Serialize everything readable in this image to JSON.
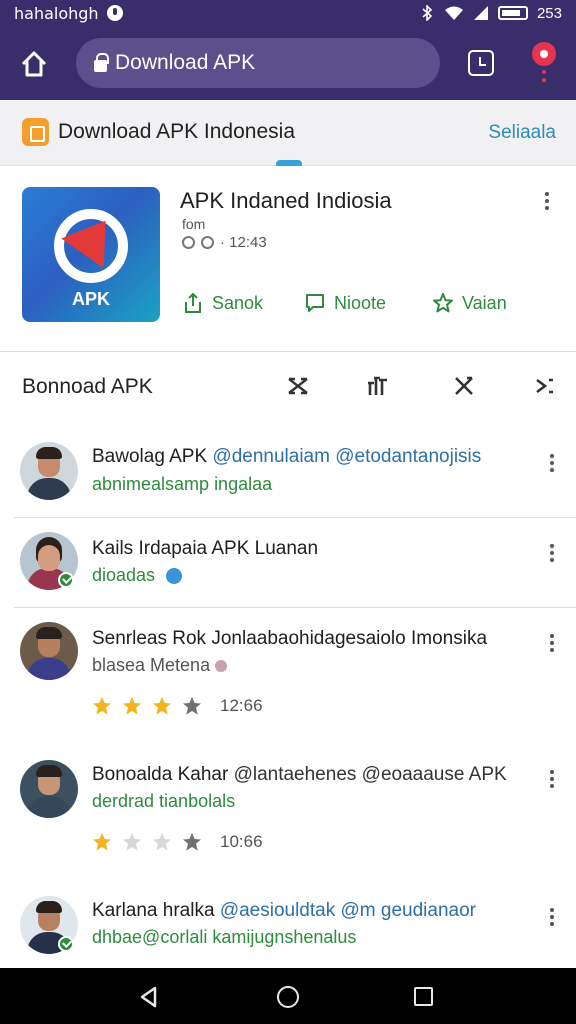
{
  "status_bar": {
    "carrier": "hahalohgh",
    "battery": "253"
  },
  "browser": {
    "url_text": "Download APK"
  },
  "site": {
    "title": "Download APK Indonesia",
    "link": "Seliaala"
  },
  "app": {
    "name": "APK Indaned Indiosia",
    "subtitle": "fom",
    "meta_time": "· 12:43",
    "icon_label": "APK",
    "actions": [
      {
        "label": "Sanok",
        "icon": "share-icon"
      },
      {
        "label": "Nioote",
        "icon": "comment-icon"
      },
      {
        "label": "Vaian",
        "icon": "star-outline-icon"
      }
    ]
  },
  "section": {
    "title": "Bonnoad APK"
  },
  "items": [
    {
      "name": "Bawolag APK",
      "mention": "@denn​u​laiam @etodantanojisis",
      "line2": "abnimealsamp ingalaa",
      "verified": false
    },
    {
      "name": "Kails Irdapaia APK Luanan",
      "mention": "",
      "line2": "dioadas",
      "verified": true
    },
    {
      "name": "Senrleas Rok Jonlaabaohidagesaiolo Imonsika",
      "mention": "",
      "line2": "blasea Metena",
      "rating": 3,
      "rating_time": "12:66",
      "verified": false
    },
    {
      "name": "Bonoalda Kahar",
      "mention": "@lantaehenes @eoaaause APK",
      "line2": "derdrad tianbolals",
      "rating": 1,
      "rating_time": "10:66",
      "verified": false
    },
    {
      "name": "Karlana hralka",
      "mention": "@aesiouldtak @m geudianaor",
      "line2": "dhbae@corlali kamijugnshenalus",
      "verified": true
    }
  ],
  "colors": {
    "toolbar": "#3a2d6b",
    "accent_green": "#2e8b3e",
    "link_blue": "#2d8bb6",
    "star_gold": "#f2b51e"
  }
}
